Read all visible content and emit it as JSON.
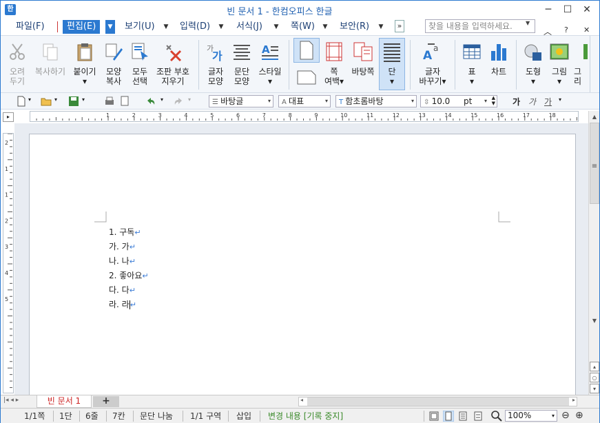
{
  "window": {
    "title": "빈 문서 1 - 한컴오피스 한글",
    "app_icon": "hwp-app-icon"
  },
  "window_buttons": {
    "minimize": "─",
    "maximize": "☐",
    "close": "✕"
  },
  "menu": {
    "items": [
      {
        "label": "파일(F)"
      },
      {
        "label": "편집(E)",
        "active": true
      },
      {
        "label": "보기(U)"
      },
      {
        "label": "입력(D)"
      },
      {
        "label": "서식(J)"
      },
      {
        "label": "쪽(W)"
      },
      {
        "label": "보안(R)"
      }
    ],
    "search_placeholder": "찾을 내용을 입력하세요.",
    "caret": "▼",
    "expand": "»",
    "right_icons": {
      "collapse": "︿",
      "help": "?",
      "close": "✕"
    }
  },
  "ribbon": {
    "buttons": [
      {
        "line1": "오려",
        "line2": "두기",
        "disabled": true
      },
      {
        "line1": "복사하기",
        "line2": "",
        "disabled": true
      },
      {
        "line1": "붙이기",
        "line2": "▾"
      },
      {
        "line1": "모양",
        "line2": "복사"
      },
      {
        "line1": "모두",
        "line2": "선택"
      },
      {
        "line1": "조판 부호",
        "line2": "지우기"
      },
      {
        "line1": "글자",
        "line2": "모양"
      },
      {
        "line1": "문단",
        "line2": "모양"
      },
      {
        "line1": "스타일",
        "line2": "▾"
      },
      {
        "line1": "쪽",
        "line2": "여백▾"
      },
      {
        "line1": "바탕쪽",
        "line2": ""
      },
      {
        "line1": "단",
        "line2": "▾"
      },
      {
        "line1": "글자",
        "line2": "바꾸기▾"
      },
      {
        "line1": "표",
        "line2": "▾"
      },
      {
        "line1": "차트",
        "line2": ""
      },
      {
        "line1": "도형",
        "line2": "▾"
      },
      {
        "line1": "그림",
        "line2": "▾"
      },
      {
        "line1": "그리",
        "line2": ""
      }
    ],
    "more": "▾"
  },
  "toolbar": {
    "style_combo": "바탕글",
    "font_lang_combo": "대표",
    "font_combo": "함초롬바탕",
    "size_value": "10.0",
    "size_unit": "pt",
    "char_styles": {
      "bold": "가",
      "italic": "가",
      "underline": "가"
    },
    "dropdown_caret": "▾"
  },
  "ruler": {
    "h_numbers": [
      "1",
      "2",
      "3",
      "4",
      "5",
      "6",
      "7",
      "8",
      "9",
      "10",
      "11",
      "12",
      "13",
      "14",
      "15",
      "16",
      "17",
      "18"
    ],
    "v_numbers": [
      "2",
      "1",
      "1",
      "2",
      "3",
      "4",
      "5"
    ]
  },
  "document": {
    "lines": [
      {
        "text": "1. 구독"
      },
      {
        "text": "가. 가"
      },
      {
        "text": "나. 나"
      },
      {
        "text": "2. 좋아요"
      },
      {
        "text": "다. 다"
      },
      {
        "text": "라. 라"
      }
    ],
    "para_mark": "↵"
  },
  "tabs": {
    "doc_tab": "빈 문서 1",
    "add_tab": "+"
  },
  "status": {
    "page": "1/1쪽",
    "column": "1단",
    "line": "6줄",
    "char": "7칸",
    "break": "문단 나눔",
    "section": "1/1 구역",
    "mode": "삽입",
    "track": "변경 내용 [기록 중지]",
    "zoom": "100%",
    "zoom_out": "⊖",
    "zoom_in": "⊕"
  },
  "colors": {
    "accent": "#2b79d0",
    "track": "#3a8a2a",
    "tab_text": "#c22222"
  }
}
